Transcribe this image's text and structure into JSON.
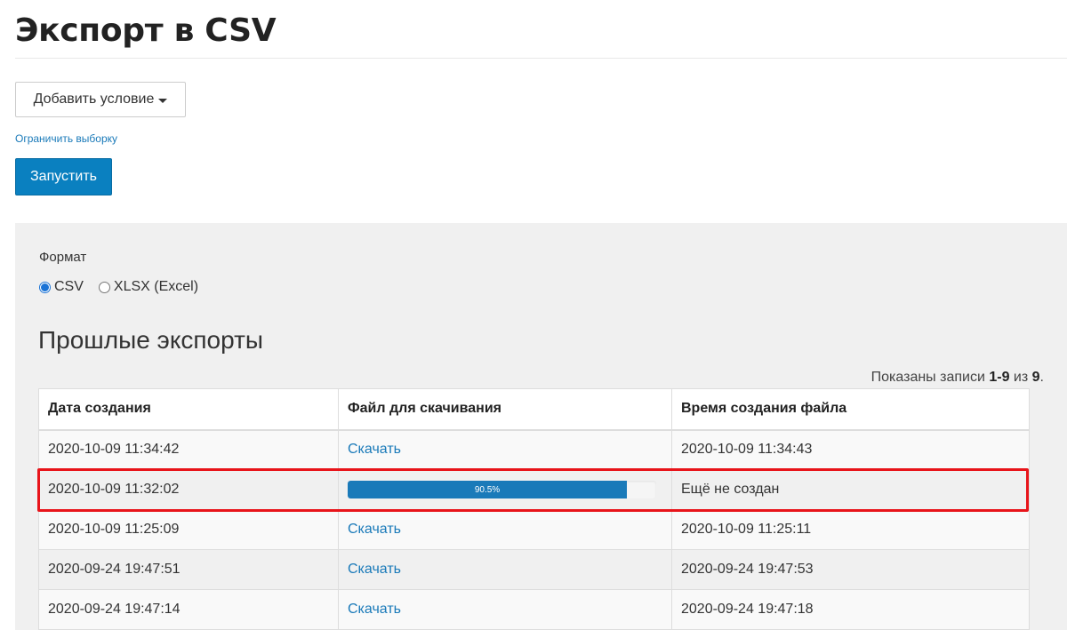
{
  "page": {
    "title": "Экспорт в CSV"
  },
  "filters": {
    "add_condition_label": "Добавить условие",
    "limit_link": "Ограничить выборку"
  },
  "actions": {
    "run_label": "Запустить"
  },
  "format": {
    "label": "Формат",
    "options": [
      {
        "label": "CSV",
        "checked": true
      },
      {
        "label": "XLSX (Excel)",
        "checked": false
      }
    ]
  },
  "past_exports": {
    "title": "Прошлые экспорты",
    "records_prefix": "Показаны записи ",
    "records_range": "1-9",
    "records_mid": " из ",
    "records_total": "9",
    "records_suffix": ".",
    "columns": [
      "Дата создания",
      "Файл для скачивания",
      "Время создания файла"
    ],
    "rows": [
      {
        "created": "2020-10-09 11:34:42",
        "file": "Скачать",
        "file_created": "2020-10-09 11:34:43"
      },
      {
        "created": "2020-10-09 11:32:02",
        "progress": 0.905,
        "progress_label": "90.5%",
        "file_created": "Ещё не создан"
      },
      {
        "created": "2020-10-09 11:25:09",
        "file": "Скачать",
        "file_created": "2020-10-09 11:25:11"
      },
      {
        "created": "2020-09-24 19:47:51",
        "file": "Скачать",
        "file_created": "2020-09-24 19:47:53"
      },
      {
        "created": "2020-09-24 19:47:14",
        "file": "Скачать",
        "file_created": "2020-09-24 19:47:18"
      }
    ]
  },
  "colors": {
    "accent": "#0a80c0",
    "link": "#1a7ab9",
    "highlight": "#e8141a",
    "panel_bg": "#f0f0f0"
  }
}
